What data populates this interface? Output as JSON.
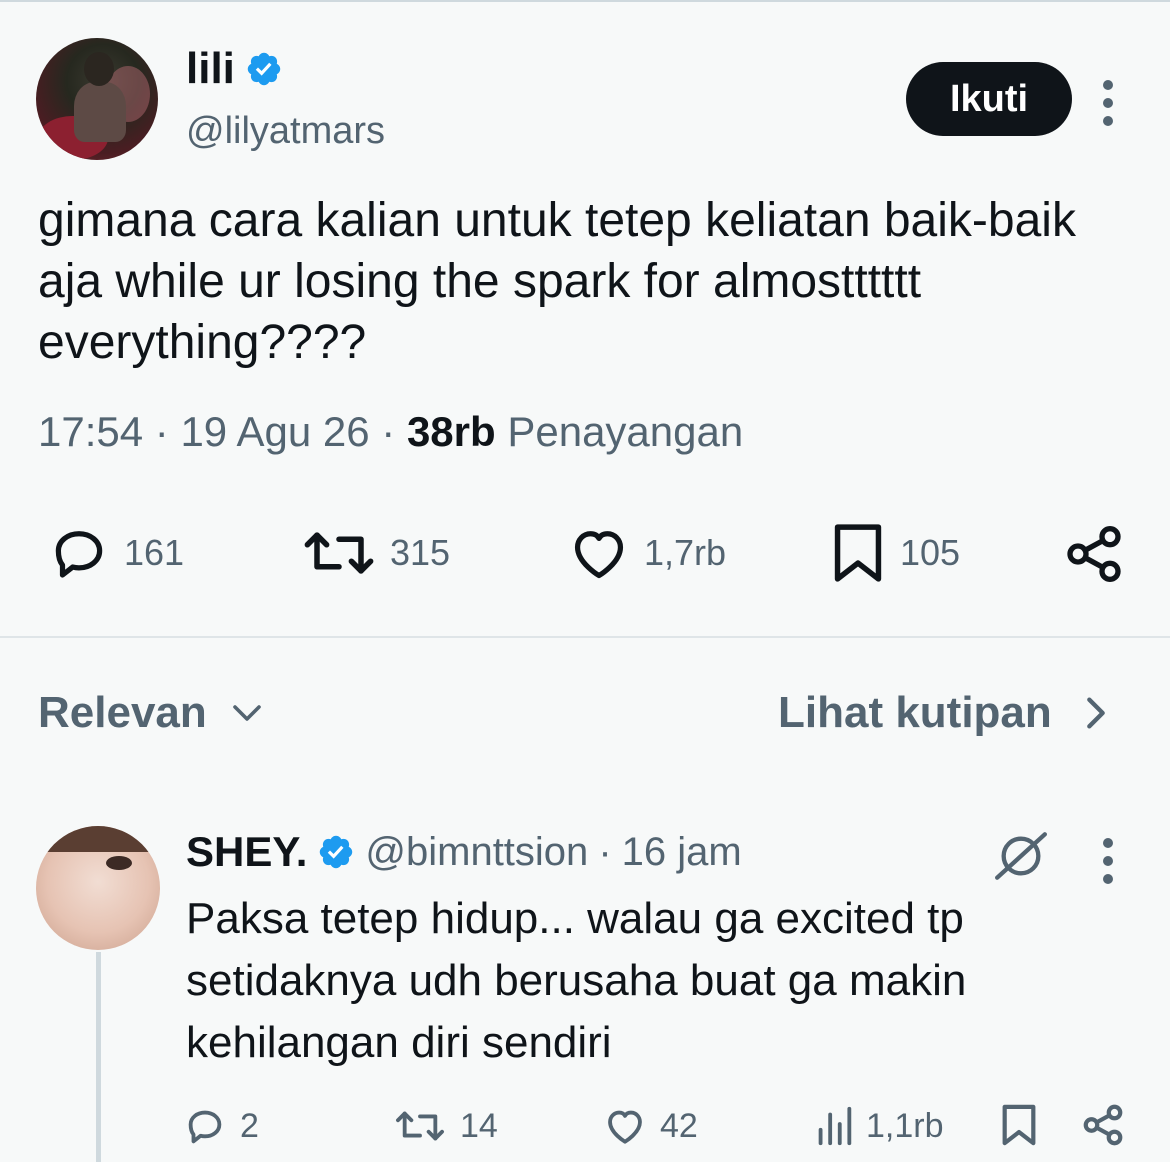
{
  "tweet": {
    "author_name": "lili",
    "author_handle": "@lilyatmars",
    "follow_label": "Ikuti",
    "text": "gimana cara kalian untuk tetep keliatan baik-baik aja while ur losing the spark for almostttttt everything????",
    "time": "17:54",
    "date": "19 Agu 26",
    "views_count": "38rb",
    "views_label": "Penayangan",
    "stats": {
      "replies": "161",
      "retweets": "315",
      "likes": "1,7rb",
      "bookmarks": "105"
    }
  },
  "replies_bar": {
    "sort_label": "Relevan",
    "quotes_label": "Lihat kutipan"
  },
  "reply": {
    "author_name": "SHEY.",
    "author_handle": "@bimnttsion",
    "time_ago": "16 jam",
    "text": "Paksa tetep hidup... walau ga excited tp setidaknya udh berusaha buat ga makin kehilangan diri sendiri",
    "stats": {
      "replies": "2",
      "retweets": "14",
      "likes": "42",
      "views": "1,1rb"
    }
  },
  "colors": {
    "background": "#f7f9f9",
    "text": "#0f1419",
    "secondary": "#536471",
    "verified": "#1d9bf0"
  }
}
